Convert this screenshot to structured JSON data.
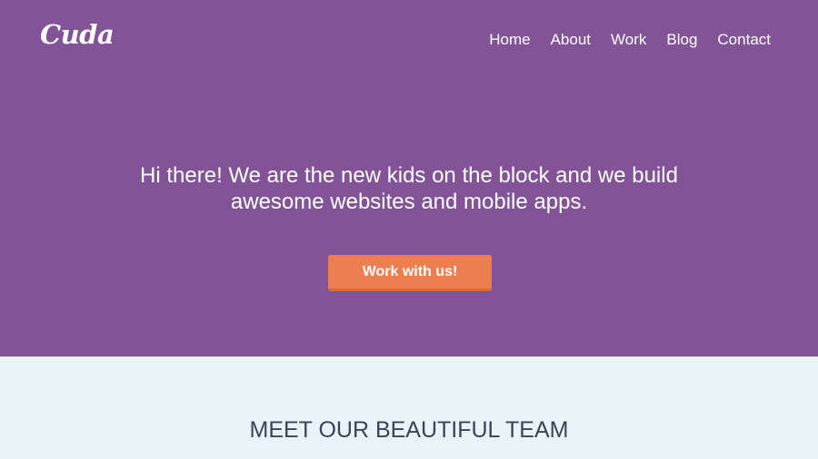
{
  "header": {
    "logo": "Cuda",
    "nav": [
      {
        "label": "Home"
      },
      {
        "label": "About"
      },
      {
        "label": "Work"
      },
      {
        "label": "Blog"
      },
      {
        "label": "Contact"
      }
    ]
  },
  "hero": {
    "headline_line1": "Hi there! We are the new kids on the block and we build",
    "headline_line2": "awesome websites and mobile apps.",
    "cta_label": "Work with us!"
  },
  "team": {
    "title": "MEET OUR BEAUTIFUL TEAM"
  },
  "colors": {
    "hero_bg": "#825497",
    "cta_bg": "#ec7e52",
    "team_bg": "#e8f3f7",
    "team_title": "#3c4257"
  }
}
